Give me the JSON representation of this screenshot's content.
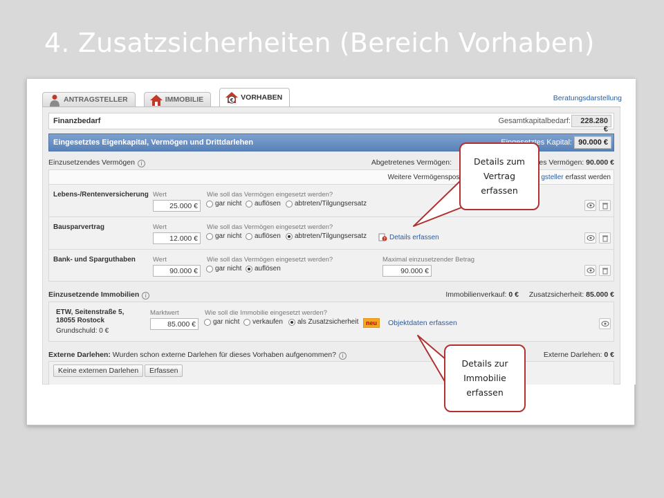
{
  "slide": {
    "title": "4. Zusatzsicherheiten (Bereich Vorhaben)"
  },
  "tabs": [
    {
      "label": "ANTRAGSTELLER",
      "icon": "person-icon"
    },
    {
      "label": "IMMOBILIE",
      "icon": "house-icon"
    },
    {
      "label": "VORHABEN",
      "icon": "house-euro-icon"
    }
  ],
  "header": {
    "consult_link": "Beratungsdarstellung"
  },
  "finanzbedarf": {
    "label": "Finanzbedarf",
    "total_label": "Gesamtkapitalbedarf:",
    "total_value": "228.280 €"
  },
  "eigenkapital": {
    "label": "Eingesetztes Eigenkapital, Vermögen und Drittdarlehen",
    "capital_label": "Eingesetztes Kapital:",
    "capital_value": "90.000 €"
  },
  "vermoegen": {
    "label": "Einzusetzendes Vermögen",
    "abgetreten_label": "Abgetretenes Vermögen:",
    "eingesetzt_label": "es Vermögen:",
    "eingesetzt_value": "90.000 €",
    "hint_start": "Weitere Vermögenspos",
    "hint_link": "gsteller",
    "hint_end": "erfasst werden",
    "rows": [
      {
        "name": "Lebens-/Rentenversicherung",
        "wert_label": "Wert",
        "wert": "25.000 €",
        "question": "Wie soll das Vermögen eingesetzt werden?",
        "options": [
          "gar nicht",
          "auflösen",
          "abtreten/Tilgungsersatz"
        ]
      },
      {
        "name": "Bausparvertrag",
        "wert_label": "Wert",
        "wert": "12.000 €",
        "question": "Wie soll das Vermögen eingesetzt werden?",
        "options": [
          "gar nicht",
          "auflösen",
          "abtreten/Tilgungsersatz"
        ],
        "link": "Details erfassen"
      },
      {
        "name": "Bank- und Sparguthaben",
        "wert_label": "Wert",
        "wert": "90.000 €",
        "question": "Wie soll das Vermögen eingesetzt werden?",
        "options": [
          "gar nicht",
          "auflösen"
        ],
        "max_label": "Maximal einzusetzender Betrag",
        "max_value": "90.000 €"
      }
    ]
  },
  "immobilien": {
    "label": "Einzusetzende Immobilien",
    "verkauf_label": "Immobilienverkauf:",
    "verkauf_value": "0 €",
    "sicherheit_label": "Zusatzsicherheit:",
    "sicherheit_value": "85.000 €",
    "object_line1": "ETW, Seitenstraße 5,",
    "object_line2": "18055 Rostock",
    "grundschuld_label": "Grundschuld:",
    "grundschuld_value": "0 €",
    "marktwert_label": "Marktwert",
    "marktwert": "85.000 €",
    "question": "Wie soll die Immobilie eingesetzt werden?",
    "options": [
      "gar nicht",
      "verkaufen",
      "als Zusatzsicherheit"
    ],
    "badge": "neu",
    "link": "Objektdaten erfassen"
  },
  "externe": {
    "label": "Externe Darlehen:",
    "question": "Wurden schon externe Darlehen für dieses Vorhaben aufgenommen?",
    "total_label": "Externe Darlehen:",
    "total_value": "0 €",
    "btn_none": "Keine externen Darlehen",
    "btn_add": "Erfassen"
  },
  "callouts": {
    "vertrag": [
      "Details zum",
      "Vertrag",
      "erfassen"
    ],
    "immobilie": [
      "Details zur",
      "Immobilie",
      "erfassen"
    ]
  },
  "colors": {
    "callout_border": "#b03030",
    "bluebar": "#6b90c4",
    "badge": "#f5a623"
  }
}
